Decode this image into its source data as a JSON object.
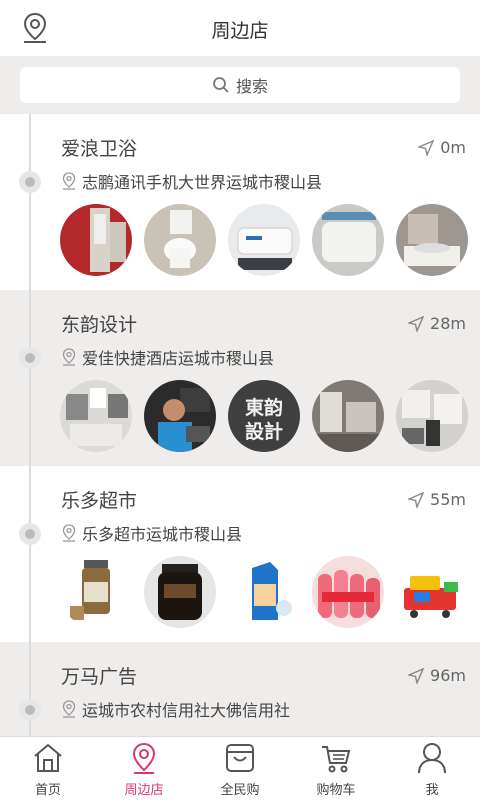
{
  "header": {
    "title": "周边店",
    "location_icon": "location-pin-icon"
  },
  "search": {
    "label": "搜索",
    "icon": "search-icon"
  },
  "stores": [
    {
      "name": "爱浪卫浴",
      "distance": "0m",
      "address": "志鹏通讯手机大世界运城市稷山县",
      "thumb_count": 5
    },
    {
      "name": "东韵设计",
      "distance": "28m",
      "address": "爱佳快捷酒店运城市稷山县",
      "thumb_count": 5,
      "thumb_text": [
        "東韵",
        "設計"
      ]
    },
    {
      "name": "乐多超市",
      "distance": "55m",
      "address": "乐多超市运城市稷山县",
      "thumb_count": 5
    },
    {
      "name": "万马广告",
      "distance": "96m",
      "address": "运城市农村信用社大佛信用社",
      "thumb_count": 0
    }
  ],
  "nav": [
    {
      "label": "首页",
      "icon": "home-icon"
    },
    {
      "label": "周边店",
      "icon": "location-pin-icon",
      "active": true
    },
    {
      "label": "全民购",
      "icon": "shopping-bag-icon"
    },
    {
      "label": "购物车",
      "icon": "cart-icon"
    },
    {
      "label": "我",
      "icon": "user-icon"
    }
  ],
  "colors": {
    "accent": "#d83a6a",
    "background": "#f1efed",
    "timeline": "#dcdcdc"
  }
}
